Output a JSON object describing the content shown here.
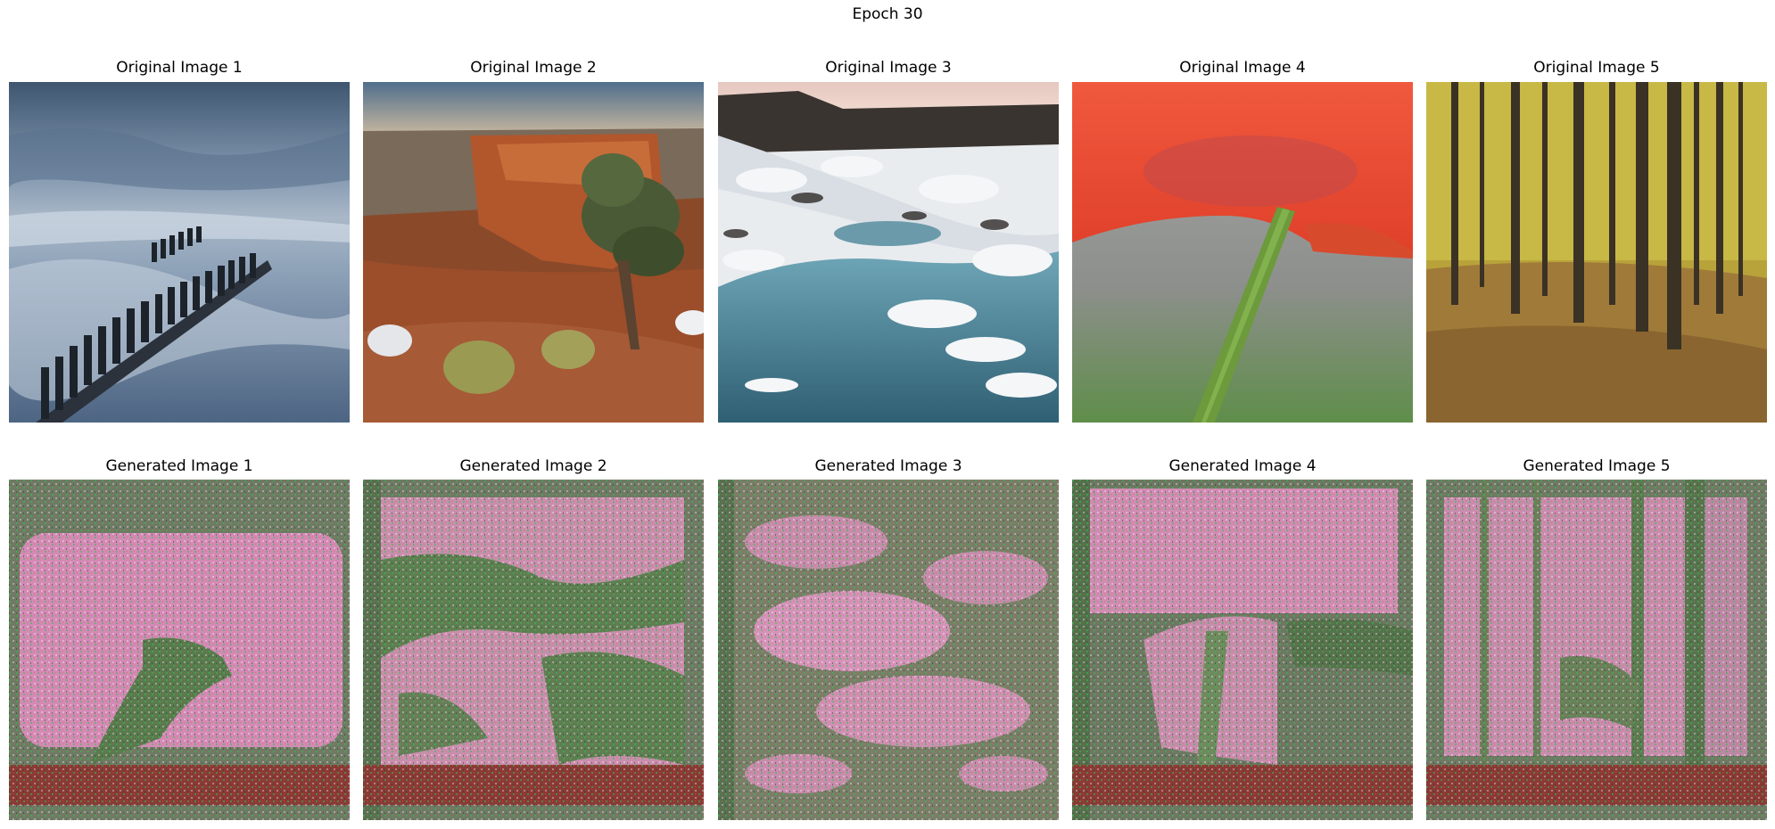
{
  "figure": {
    "title": "Epoch 30"
  },
  "originals": [
    {
      "label": "Original Image 1"
    },
    {
      "label": "Original Image 2"
    },
    {
      "label": "Original Image 3"
    },
    {
      "label": "Original Image 4"
    },
    {
      "label": "Original Image 5"
    }
  ],
  "generated": [
    {
      "label": "Generated Image 1"
    },
    {
      "label": "Generated Image 2"
    },
    {
      "label": "Generated Image 3"
    },
    {
      "label": "Generated Image 4"
    },
    {
      "label": "Generated Image 5"
    }
  ]
}
